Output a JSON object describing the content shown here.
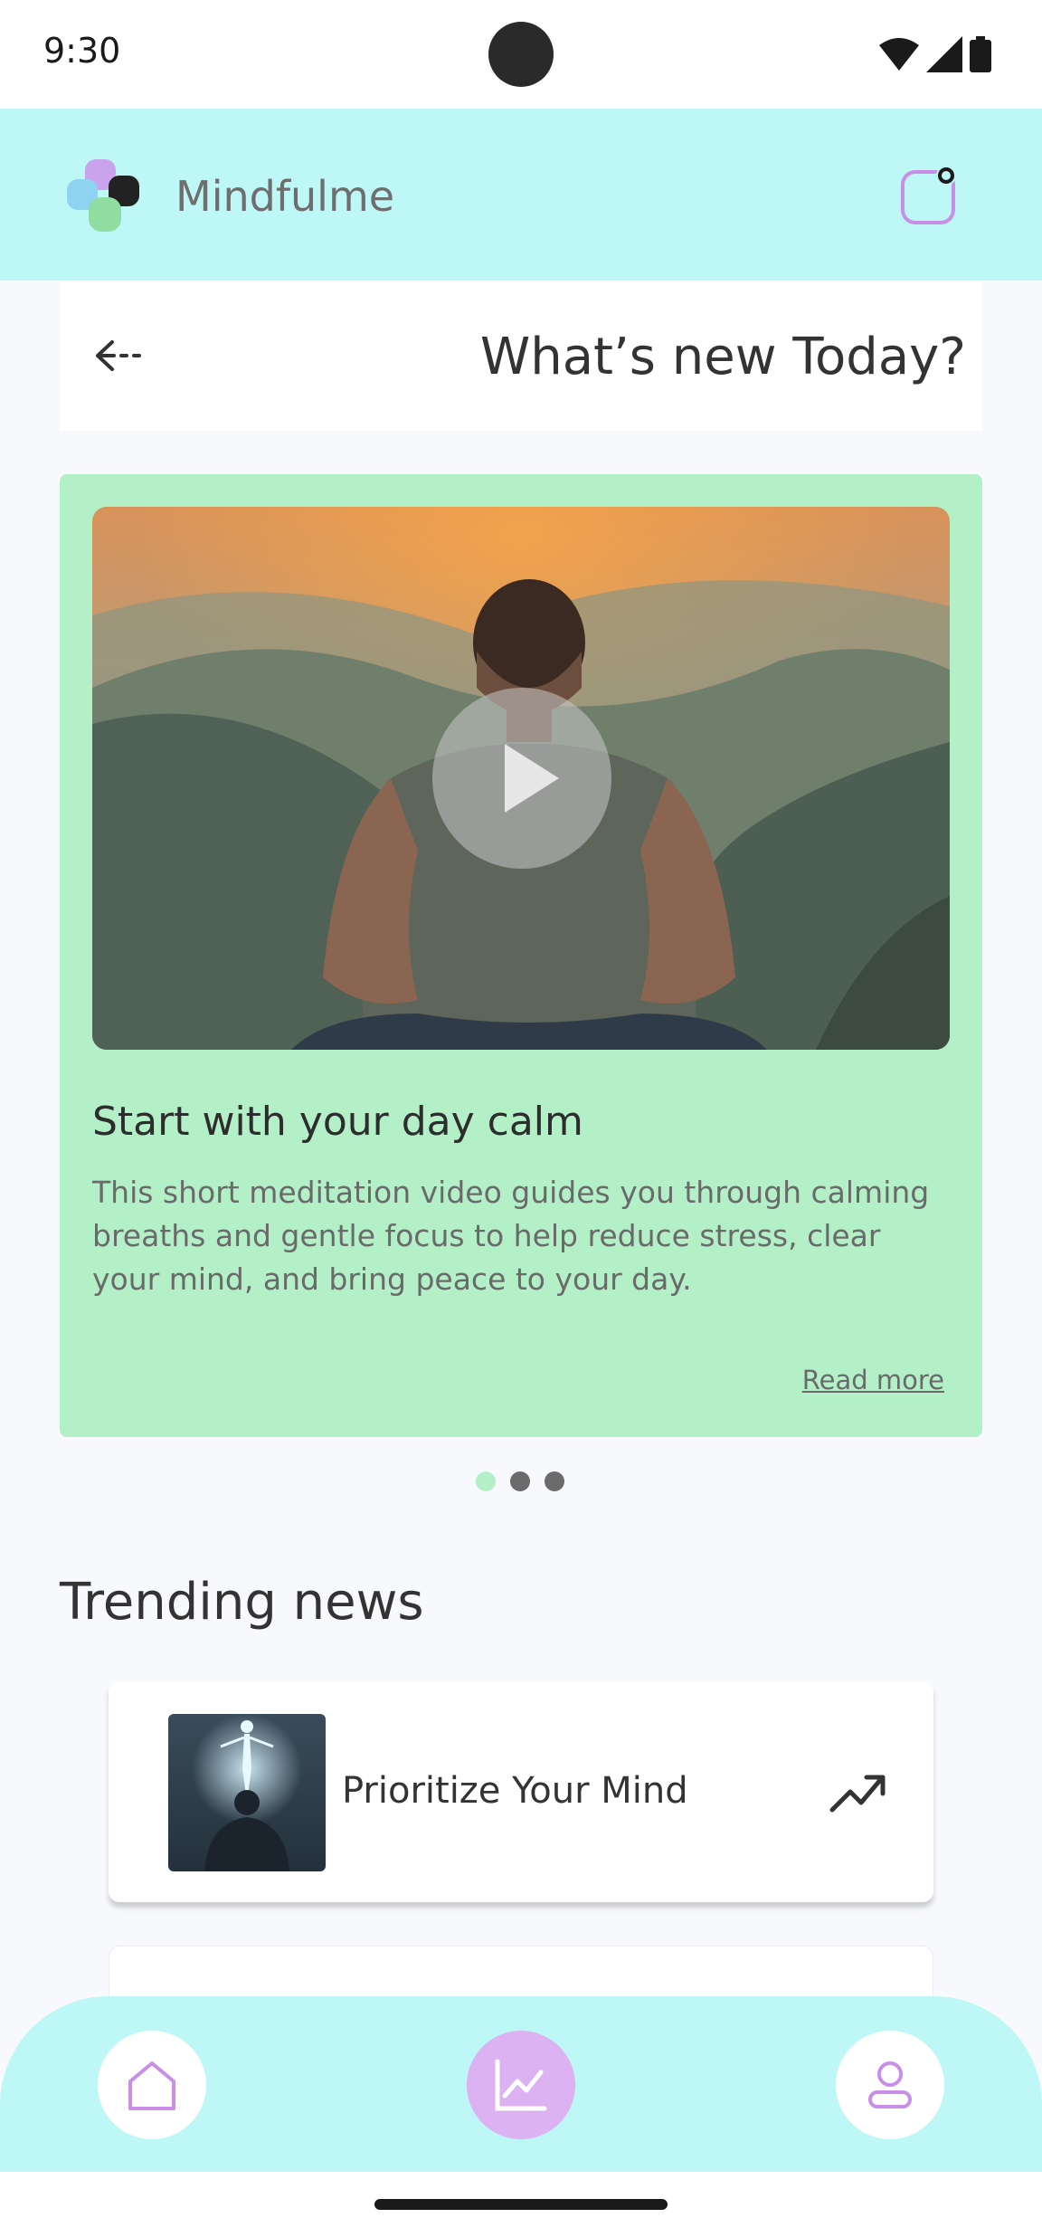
{
  "status_bar": {
    "time": "9:30",
    "icons": [
      "wifi-icon",
      "signal-icon",
      "battery-icon"
    ]
  },
  "header": {
    "app_name": "Mindfulme",
    "logo_icon": "mindfulme-logo-icon",
    "notification_icon": "notification-icon"
  },
  "title_bar": {
    "back_icon": "back-arrow-icon",
    "title": "What’s new Today?"
  },
  "featured": {
    "media_icon": "play-icon",
    "heading": "Start with your day calm",
    "description": "This short meditation video guides you through calming breaths and gentle focus to help reduce stress, clear your mind, and bring peace to your day.",
    "read_more": "Read more",
    "carousel_index": 1,
    "carousel_count": 3
  },
  "trending": {
    "title": "Trending news",
    "items": [
      {
        "title": "Prioritize Your Mind",
        "icon": "trending-up-icon"
      }
    ]
  },
  "bottom_nav": {
    "items": [
      {
        "name": "home",
        "icon": "home-icon",
        "active": false
      },
      {
        "name": "stats",
        "icon": "chart-icon",
        "active": true
      },
      {
        "name": "profile",
        "icon": "profile-icon",
        "active": false
      }
    ]
  },
  "colors": {
    "header_bg": "#bdf7f6",
    "card_bg": "#b3f0c8",
    "active_nav": "#ddb2f2",
    "accent_purple": "#c98ee8"
  }
}
